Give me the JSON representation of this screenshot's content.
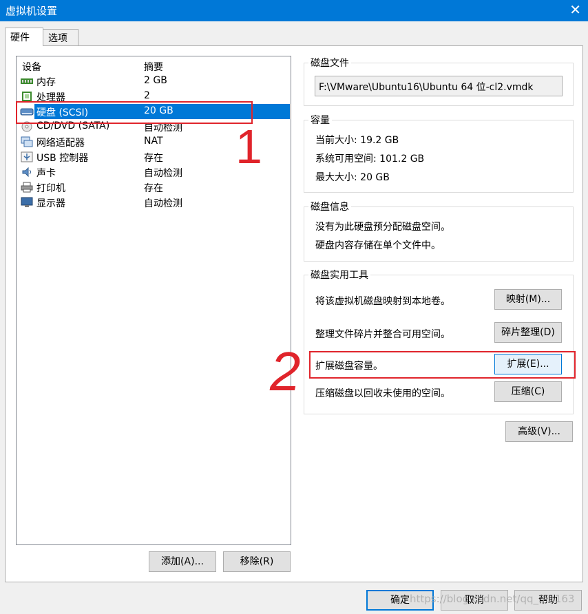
{
  "window": {
    "title": "虚拟机设置",
    "close_glyph": "✕"
  },
  "tabs": [
    {
      "label": "硬件",
      "active": true
    },
    {
      "label": "选项",
      "active": false
    }
  ],
  "device_list": {
    "columns": [
      "设备",
      "摘要"
    ],
    "rows": [
      {
        "name": "内存",
        "summary": "2 GB",
        "icon": "memory-icon"
      },
      {
        "name": "处理器",
        "summary": "2",
        "icon": "processor-icon"
      },
      {
        "name": "硬盘 (SCSI)",
        "summary": "20 GB",
        "icon": "harddisk-icon",
        "selected": true
      },
      {
        "name": "CD/DVD (SATA)",
        "summary": "自动检测",
        "icon": "cdrom-icon"
      },
      {
        "name": "网络适配器",
        "summary": "NAT",
        "icon": "network-adapter-icon"
      },
      {
        "name": "USB 控制器",
        "summary": "存在",
        "icon": "usb-icon"
      },
      {
        "name": "声卡",
        "summary": "自动检测",
        "icon": "sound-card-icon"
      },
      {
        "name": "打印机",
        "summary": "存在",
        "icon": "printer-icon"
      },
      {
        "name": "显示器",
        "summary": "自动检测",
        "icon": "display-icon"
      }
    ],
    "add_button": "添加(A)...",
    "remove_button": "移除(R)"
  },
  "disk_file": {
    "legend": "磁盘文件",
    "path": "F:\\VMware\\Ubuntu16\\Ubuntu 64 位-cl2.vmdk"
  },
  "capacity": {
    "legend": "容量",
    "current_size": "当前大小: 19.2 GB",
    "available_space": "系统可用空间: 101.2 GB",
    "max_size": "最大大小: 20 GB"
  },
  "disk_info": {
    "legend": "磁盘信息",
    "line1": "没有为此硬盘预分配磁盘空间。",
    "line2": "硬盘内容存储在单个文件中。"
  },
  "disk_utilities": {
    "legend": "磁盘实用工具",
    "map_text": "将该虚拟机磁盘映射到本地卷。",
    "map_button": "映射(M)...",
    "defrag_text": "整理文件碎片并整合可用空间。",
    "defrag_button": "碎片整理(D)",
    "expand_text": "扩展磁盘容量。",
    "expand_button": "扩展(E)...",
    "compact_text": "压缩磁盘以回收未使用的空间。",
    "compact_button": "压缩(C)"
  },
  "advanced_button": "高级(V)...",
  "footer": {
    "ok": "确定",
    "cancel": "取消",
    "help": "帮助"
  },
  "annotations": {
    "mark1": "1",
    "mark2": "2",
    "color": "#e0242b"
  },
  "watermark": "https://blog.csdn.net/qq_3...163"
}
